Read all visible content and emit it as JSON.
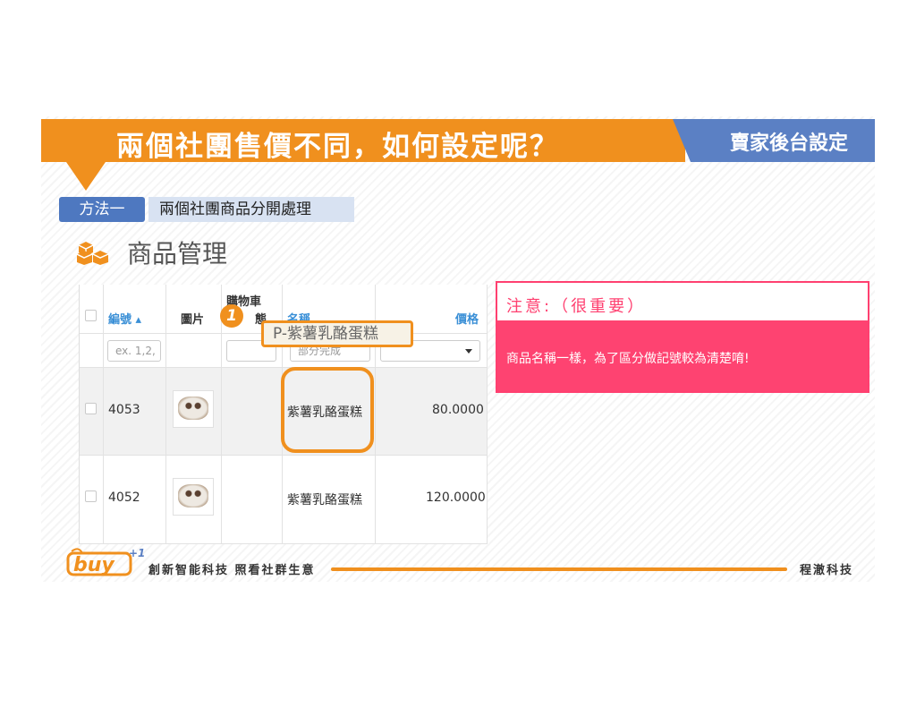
{
  "banner": {
    "title": "兩個社團售價不同，如何設定呢？",
    "right_label": "賣家後台設定"
  },
  "method": {
    "tag": "方法一",
    "description": "兩個社團商品分開處理"
  },
  "page_title": "商品管理",
  "table": {
    "headers": {
      "id": "編號 ▴",
      "image": "圖片",
      "cart": "購物車",
      "cart_sub": "態",
      "name": "名稱",
      "price": "價格"
    },
    "filters": {
      "id_placeholder": "ex. 1,2,",
      "name_placeholder": "部分完成"
    },
    "rows": [
      {
        "id": "4053",
        "name": "紫薯乳酪蛋糕",
        "price": "80.0000"
      },
      {
        "id": "4052",
        "name": "紫薯乳酪蛋糕",
        "price": "120.0000"
      }
    ]
  },
  "annotation": {
    "badge": "1",
    "tooltip": "P-紫薯乳酪蛋糕"
  },
  "note": {
    "title": "注意:（很重要）",
    "body": "商品名稱一樣，為了區分做記號較為清楚唷!"
  },
  "footer": {
    "logo_text": "buy",
    "logo_sup": "+1",
    "slogan": "創新智能科技 照看社群生意",
    "company": "程澈科技"
  },
  "colors": {
    "orange": "#f0901e",
    "blue": "#5b80c4",
    "pink": "#fe4371",
    "link_blue": "#3a8fd6"
  }
}
